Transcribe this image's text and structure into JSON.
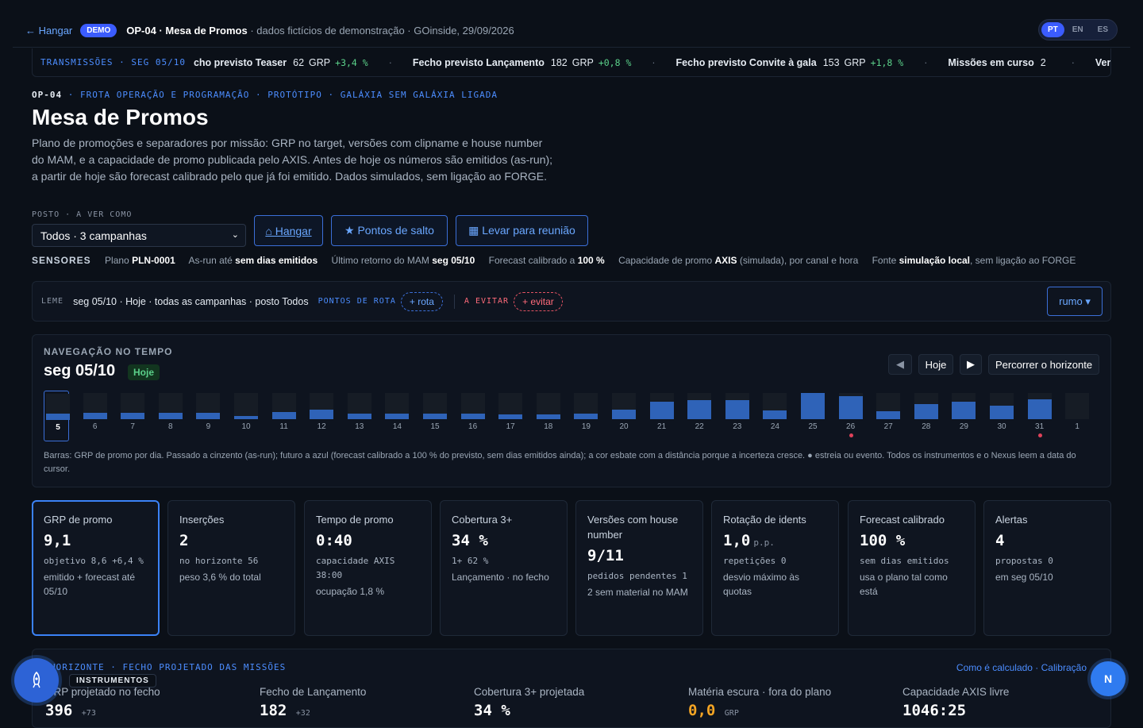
{
  "topbar": {
    "back_label": "← Hangar",
    "demo_badge": "DEMO",
    "op_title": "OP-04 · Mesa de Promos",
    "subtitle": " · dados fictícios de demonstração · GOinside, 29/09/2026",
    "languages": [
      "PT",
      "EN",
      "ES"
    ],
    "active_language": "PT"
  },
  "ticker": {
    "label": "TRANSMISSÕES · SEG 05/10",
    "items": [
      {
        "name": "cho previsto Teaser",
        "num": "62",
        "unit": "GRP",
        "delta": "+3,4 %"
      },
      {
        "name": "Fecho previsto Lançamento",
        "num": "182",
        "unit": "GRP",
        "delta": "+0,8 %"
      },
      {
        "name": "Fecho previsto Convite à gala",
        "num": "153",
        "unit": "GRP",
        "delta": "+1,8 %"
      },
      {
        "name": "Missões em curso",
        "num": "2",
        "unit": "",
        "delta": ""
      }
    ],
    "tail": "Ver"
  },
  "header": {
    "eyebrow_code": "OP-04",
    "eyebrow_rest": " · FROTA OPERAÇÃO E PROGRAMAÇÃO · PROTÓTIPO · GALÁXIA SEM GALÁXIA LIGADA",
    "title": "Mesa de Promos",
    "lede": "Plano de promoções e separadores por missão: GRP no target, versões com clipname e house number do MAM, e a capacidade de promo publicada pelo AXIS. Antes de hoje os números são emitidos (as-run); a partir de hoje são forecast calibrado pelo que já foi emitido. Dados simulados, sem ligação ao FORGE."
  },
  "posto": {
    "label": "POSTO · A VER COMO",
    "selected": "Todos · 3 campanhas"
  },
  "buttons": {
    "hangar": "⌂ Hangar",
    "pontos": "★ Pontos de salto",
    "reuniao": "▦ Levar para reunião"
  },
  "sensors": {
    "title": "SENSORES",
    "items": [
      {
        "pre": "Plano ",
        "bold": "PLN-0001",
        "post": ""
      },
      {
        "pre": "As-run até ",
        "bold": "sem dias emitidos",
        "post": ""
      },
      {
        "pre": "Último retorno do MAM ",
        "bold": "seg 05/10",
        "post": ""
      },
      {
        "pre": "Forecast calibrado a ",
        "bold": "100 %",
        "post": ""
      },
      {
        "pre": "Capacidade de promo ",
        "bold": "AXIS",
        "post": " (simulada), por canal e hora"
      },
      {
        "pre": "Fonte ",
        "bold": "simulação local",
        "post": ", sem ligação ao FORGE"
      }
    ]
  },
  "leme": {
    "label": "LEME",
    "value": "seg 05/10 · Hoje · todas as campanhas · posto Todos",
    "route_label": "PONTOS DE ROTA",
    "route_pill": "+ rota",
    "avoid_label": "A EVITAR",
    "avoid_pill": "+ evitar",
    "rumo": "rumo ▾"
  },
  "timeline": {
    "title": "NAVEGAÇÃO NO TEMPO",
    "date": "seg 05/10",
    "today_badge": "Hoje",
    "prev": "◀",
    "today_btn": "Hoje",
    "next": "▶",
    "sweep": "Percorrer o horizonte",
    "days": [
      {
        "label": "5",
        "grp": 0.25,
        "selected": true,
        "event": false
      },
      {
        "label": "6",
        "grp": 0.25,
        "event": false
      },
      {
        "label": "7",
        "grp": 0.25,
        "event": false
      },
      {
        "label": "8",
        "grp": 0.25,
        "event": false
      },
      {
        "label": "9",
        "grp": 0.25,
        "event": false
      },
      {
        "label": "10",
        "grp": 0.12,
        "event": false
      },
      {
        "label": "11",
        "grp": 0.28,
        "event": false
      },
      {
        "label": "12",
        "grp": 0.36,
        "event": false
      },
      {
        "label": "13",
        "grp": 0.22,
        "event": false
      },
      {
        "label": "14",
        "grp": 0.22,
        "event": false
      },
      {
        "label": "15",
        "grp": 0.22,
        "event": false
      },
      {
        "label": "16",
        "grp": 0.22,
        "event": false
      },
      {
        "label": "17",
        "grp": 0.18,
        "event": false
      },
      {
        "label": "18",
        "grp": 0.18,
        "event": false
      },
      {
        "label": "19",
        "grp": 0.22,
        "event": false
      },
      {
        "label": "20",
        "grp": 0.36,
        "event": false
      },
      {
        "label": "21",
        "grp": 0.68,
        "event": false
      },
      {
        "label": "22",
        "grp": 0.72,
        "event": false
      },
      {
        "label": "23",
        "grp": 0.74,
        "event": false
      },
      {
        "label": "24",
        "grp": 0.32,
        "event": false
      },
      {
        "label": "25",
        "grp": 1.0,
        "event": false
      },
      {
        "label": "26",
        "grp": 0.88,
        "event": true
      },
      {
        "label": "27",
        "grp": 0.3,
        "event": false
      },
      {
        "label": "28",
        "grp": 0.58,
        "event": false
      },
      {
        "label": "29",
        "grp": 0.66,
        "event": false
      },
      {
        "label": "30",
        "grp": 0.52,
        "event": false
      },
      {
        "label": "31",
        "grp": 0.76,
        "event": true
      },
      {
        "label": "1",
        "grp": 0.0,
        "event": false
      }
    ],
    "note": "Barras: GRP de promo por dia. Passado a cinzento (as-run); futuro a azul (forecast calibrado a 100 % do previsto, sem dias emitidos ainda); a cor esbate com a distância porque a incerteza cresce. ● estreia ou evento. Todos os instrumentos e o Nexus leem a data do cursor."
  },
  "cards": [
    {
      "head": "GRP de promo",
      "value": "9,1",
      "unit": "",
      "meta": "objetivo 8,6 +6,4 %",
      "sub": "emitido + forecast até 05/10"
    },
    {
      "head": "Inserções",
      "value": "2",
      "unit": "",
      "meta": "no horizonte 56",
      "sub": "peso 3,6 % do total"
    },
    {
      "head": "Tempo de promo",
      "value": "0:40",
      "unit": "",
      "meta": "capacidade AXIS 38:00",
      "sub": "ocupação 1,8 %"
    },
    {
      "head": "Cobertura 3+",
      "value": "34 %",
      "unit": "",
      "meta": "1+ 62 %",
      "sub": "Lançamento · no fecho"
    },
    {
      "head": "Versões com house number",
      "value": "9/11",
      "unit": "",
      "meta": "pedidos pendentes 1",
      "sub": "2 sem material no MAM"
    },
    {
      "head": "Rotação de idents",
      "value": "1,0",
      "unit": "p.p.",
      "meta": "repetições 0",
      "sub": "desvio máximo às quotas"
    },
    {
      "head": "Forecast calibrado",
      "value": "100 %",
      "unit": "",
      "meta": "sem dias emitidos",
      "sub": "usa o plano tal como está"
    },
    {
      "head": "Alertas",
      "value": "4",
      "unit": "",
      "meta": "propostas 0",
      "sub": "em seg 05/10"
    }
  ],
  "horizon": {
    "title": "HORIZONTE · FECHO PROJETADO DAS MISSÕES",
    "link": "Como é calculado · Calibração",
    "cols": [
      {
        "label": "GRP projetado no fecho",
        "value": "396",
        "small": "+73"
      },
      {
        "label": "Fecho de Lançamento",
        "value": "182",
        "small": "+32"
      },
      {
        "label": "Cobertura 3+ projetada",
        "value": "34 %",
        "small": ""
      },
      {
        "label": "Matéria escura · fora do plano",
        "value": "0,0",
        "small": "GRP"
      },
      {
        "label": "Capacidade AXIS livre",
        "value": "1046:25",
        "small": ""
      }
    ]
  },
  "fab": {
    "label": "INSTRUMENTOS",
    "icon": "rocket-icon"
  },
  "nexus": {
    "label": "N"
  },
  "colors": {
    "accent": "#3b82f6",
    "positive": "#5bd18a",
    "alert": "#e0425a",
    "background": "#0b1018"
  }
}
